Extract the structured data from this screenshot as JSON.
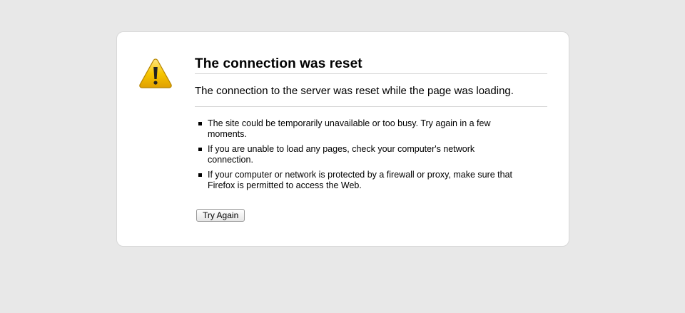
{
  "error": {
    "title": "The connection was reset",
    "short_description": "The connection to the server was reset while the page was loading.",
    "suggestions": [
      "The site could be temporarily unavailable or too busy. Try again in a few moments.",
      "If you are unable to load any pages, check your computer's network connection.",
      "If your computer or network is protected by a firewall or proxy, make sure that Firefox is permitted to access the Web."
    ],
    "try_again_label": "Try Again",
    "icon": "warning-icon"
  },
  "colors": {
    "page_background": "#e8e8e8",
    "card_background": "#ffffff",
    "warning_yellow": "#f5c400",
    "warning_dark": "#b88600"
  }
}
